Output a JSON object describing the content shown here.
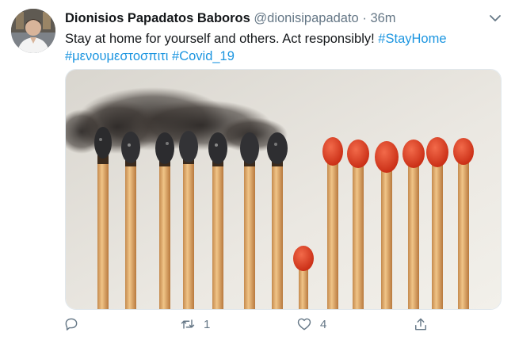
{
  "tweet": {
    "display_name": "Dionisios Papadatos Baboros",
    "handle": "@dionisipapadato",
    "separator": "·",
    "time": "36m",
    "text_plain": "Stay at home for yourself and others. Act responsibly!",
    "hashtags": [
      "#StayHome",
      "#μενουμεστοσπιτι",
      "#Covid_19"
    ]
  },
  "media": {
    "description": "Row of wooden matchsticks; seven burnt matches under a smoke cloud on the left, one fallen match standing apart, six unburnt red-tipped matches on the right"
  },
  "actions": {
    "reply_icon": "reply-icon",
    "retweet_icon": "retweet-icon",
    "retweet_count": "1",
    "like_icon": "heart-icon",
    "like_count": "4",
    "share_icon": "share-icon"
  },
  "colors": {
    "link": "#1b95e0",
    "text": "#14171a",
    "muted": "#657786",
    "match_head_red": "#d9381e"
  }
}
